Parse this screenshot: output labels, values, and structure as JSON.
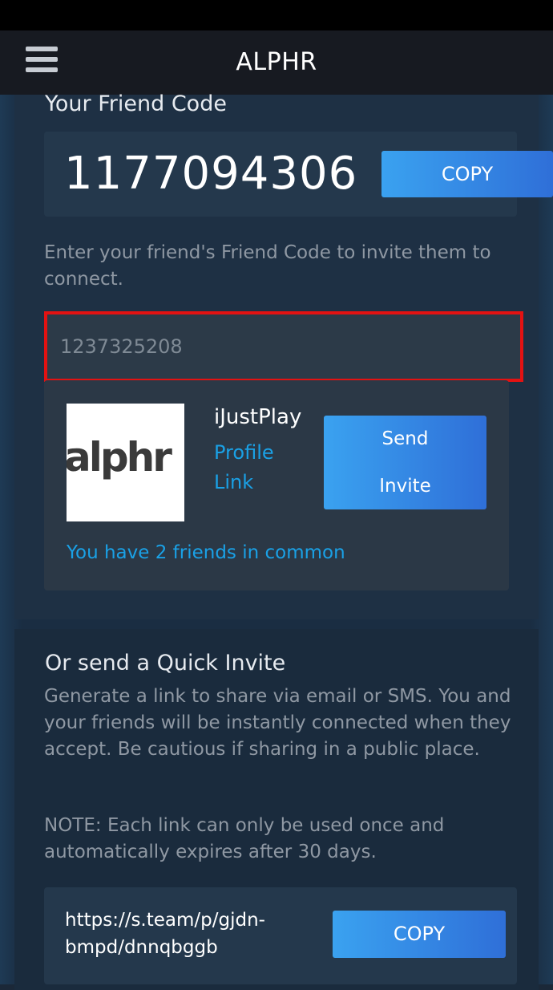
{
  "header": {
    "title": "ALPHR"
  },
  "friend_code_section": {
    "title": "Your Friend Code",
    "code": "1177094306",
    "copy_label": "COPY"
  },
  "invite": {
    "description": "Enter your friend's Friend Code to invite them to connect.",
    "input_value": "1237325208"
  },
  "result": {
    "avatar_text": "alphr",
    "username": "iJustPlay",
    "profile_link": "Profile Link",
    "send_line1": "Send",
    "send_line2": "Invite",
    "common_friends": "You have 2 friends in common"
  },
  "quick_invite": {
    "title": "Or send a Quick Invite",
    "description": "Generate a link to share via email or SMS. You and your friends will be instantly connected when they accept. Be cautious if sharing in a public place.",
    "note": "NOTE: Each link can only be used once and automatically expires after 30 days.",
    "link": "https://s.team/p/gjdn-bmpd/dnnqbggb",
    "copy_label": "COPY"
  },
  "colors": {
    "background": "#1b2838",
    "button_gradient_start": "#3aa2f0",
    "button_gradient_end": "#2f6fd8",
    "link": "#1aa1e6",
    "highlight_border": "#e31212"
  },
  "icons": {
    "menu": "hamburger-menu-icon"
  }
}
